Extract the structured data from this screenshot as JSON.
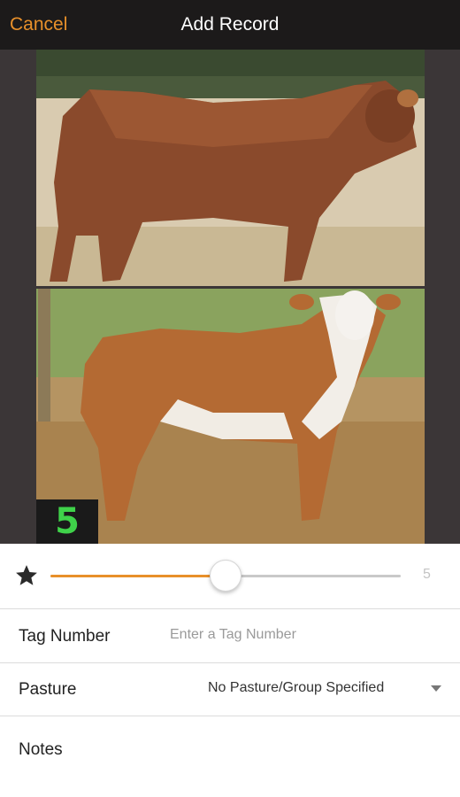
{
  "navbar": {
    "cancel_label": "Cancel",
    "title": "Add Record",
    "accent_color": "#e8902a"
  },
  "photos": {
    "top_alt": "Red cow in pasture",
    "bottom_alt": "Hereford cow in pasture",
    "score_badge": "5"
  },
  "rating": {
    "icon": "star-icon",
    "value": "5",
    "min": 1,
    "max": 9,
    "fill_fraction": 0.5
  },
  "form": {
    "tag_label": "Tag Number",
    "tag_placeholder": "Enter a Tag Number",
    "tag_value": "",
    "pasture_label": "Pasture",
    "pasture_value": "No Pasture/Group Specified",
    "notes_label": "Notes",
    "notes_value": ""
  }
}
